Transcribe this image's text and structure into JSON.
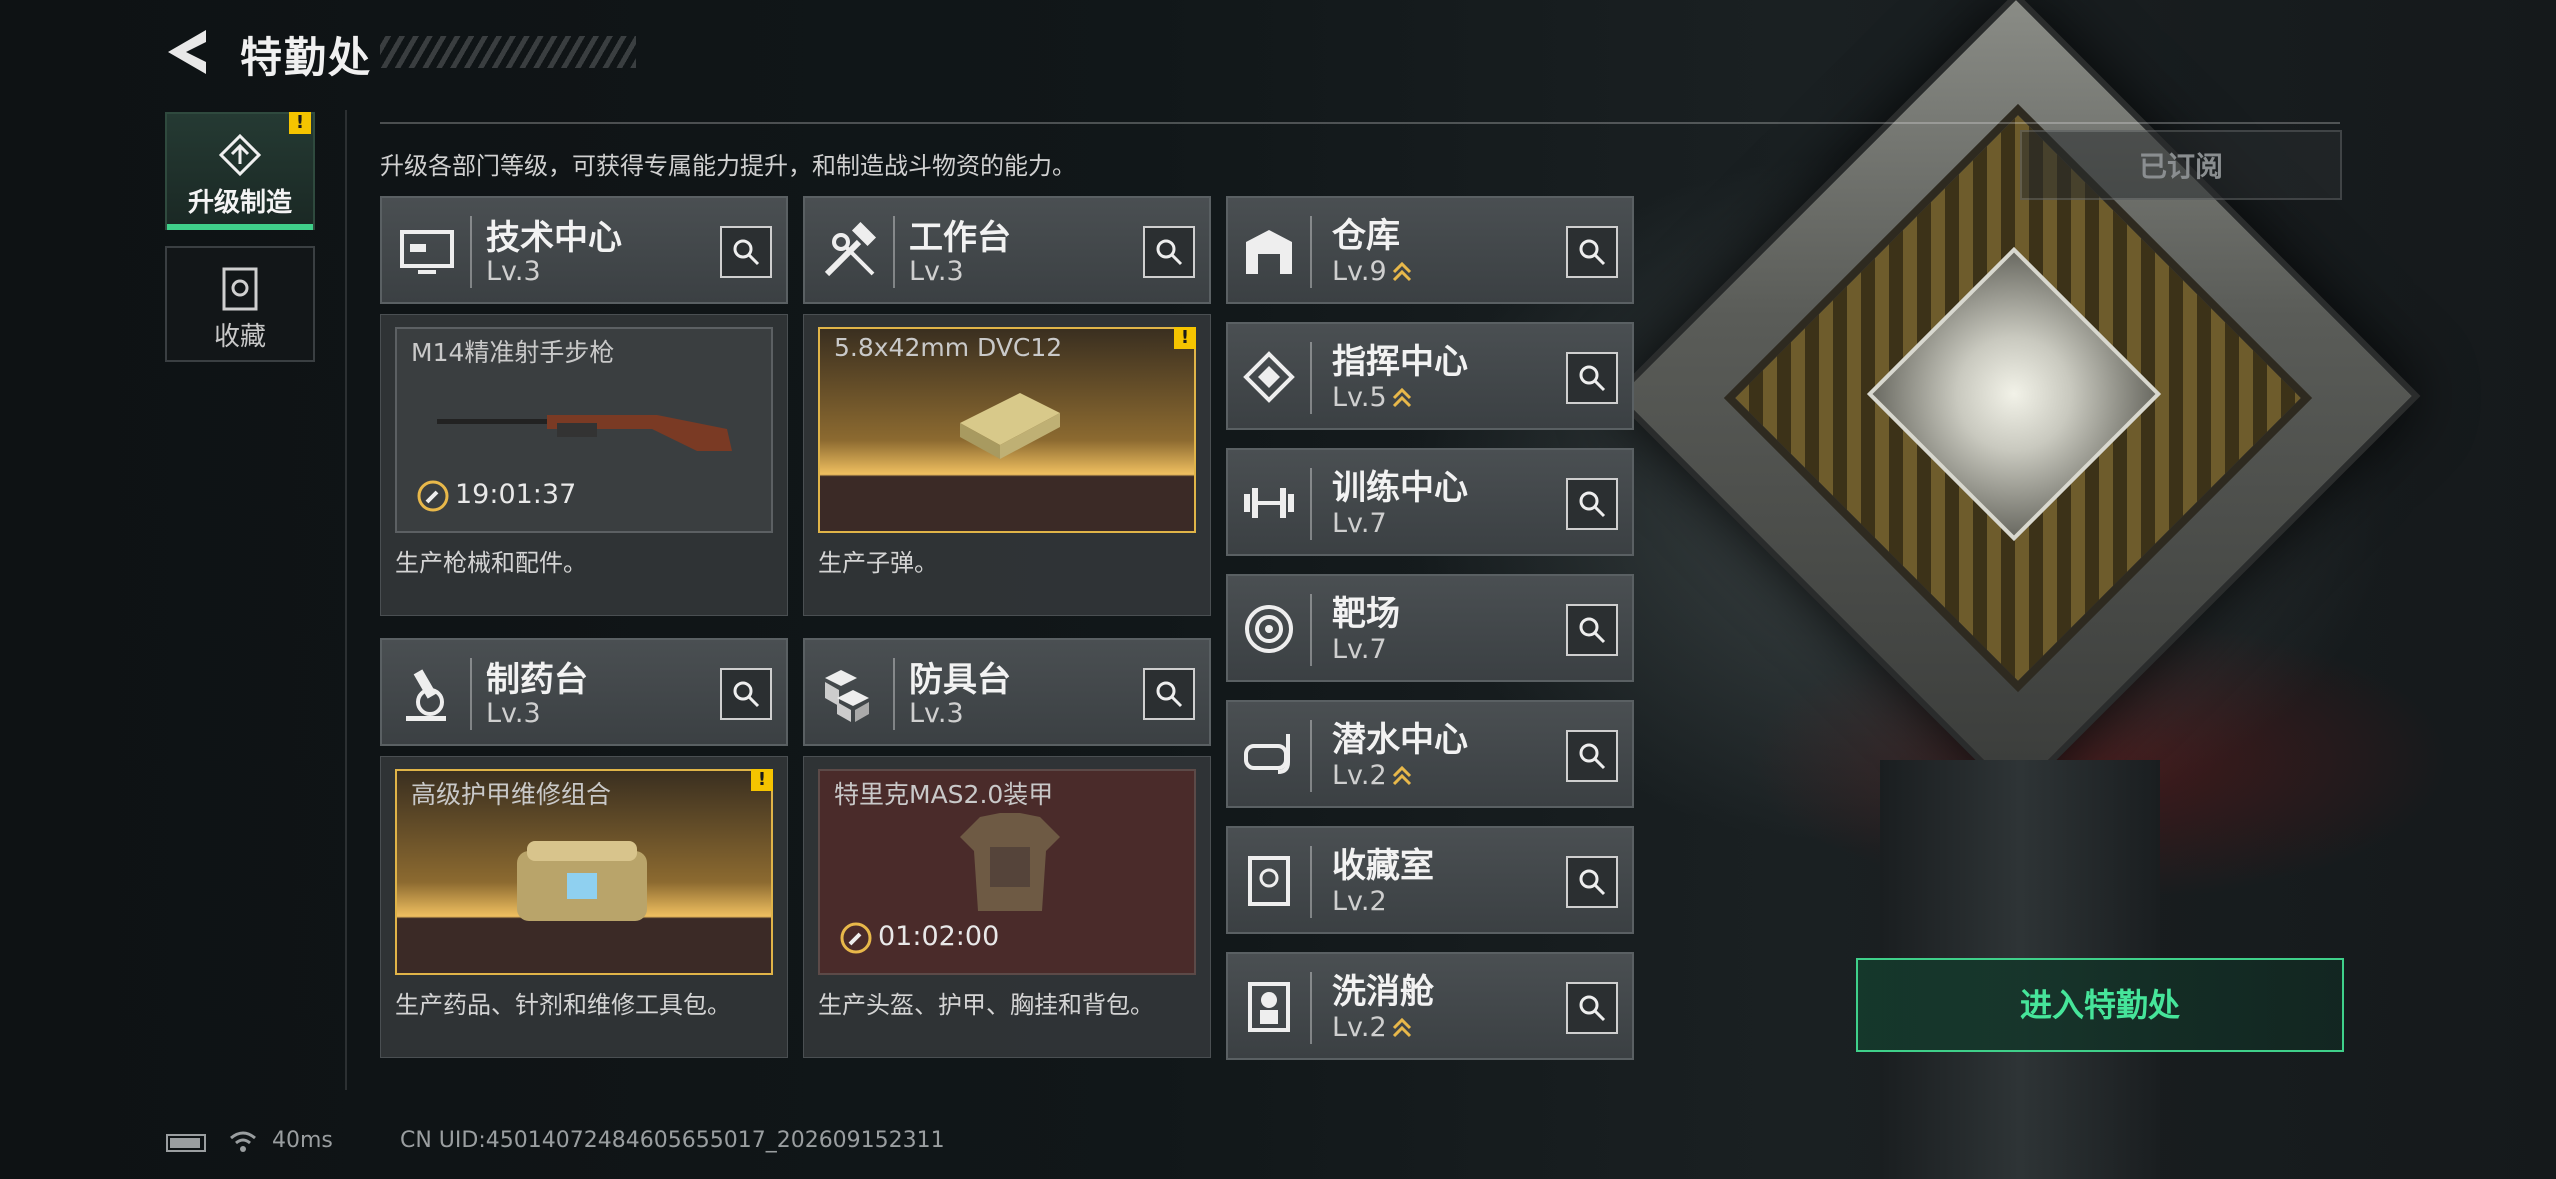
{
  "header": {
    "title": "特勤处"
  },
  "sidebar": {
    "tabs": [
      {
        "label": "升级制造",
        "active": true,
        "warning": "!"
      },
      {
        "label": "收藏",
        "active": false
      }
    ]
  },
  "description": "升级各部门等级，可获得专属能力提升，和制造战斗物资的能力。",
  "subscribed_label": "已订阅",
  "enter_button": "进入特勤处",
  "big_departments": [
    {
      "name": "技术中心",
      "level": "Lv.3",
      "product": "M14精准射手步枪",
      "timer": "19:01:37",
      "desc": "生产枪械和配件。",
      "frame": "grey",
      "icon": "monitor-icon"
    },
    {
      "name": "工作台",
      "level": "Lv.3",
      "product": "5.8x42mm DVC12",
      "timer": "",
      "desc": "生产子弹。",
      "frame": "gold",
      "warning": "!",
      "icon": "hammer-wrench-icon"
    },
    {
      "name": "制药台",
      "level": "Lv.3",
      "product": "高级护甲维修组合",
      "timer": "",
      "desc": "生产药品、针剂和维修工具包。",
      "frame": "gold",
      "warning": "!",
      "icon": "microscope-icon"
    },
    {
      "name": "防具台",
      "level": "Lv.3",
      "product": "特里克MAS2.0装甲",
      "timer": "01:02:00",
      "desc": "生产头盔、护甲、胸挂和背包。",
      "frame": "red",
      "icon": "boxes-icon"
    }
  ],
  "small_departments": [
    {
      "name": "仓库",
      "level": "Lv.9",
      "upgradable": true,
      "icon": "warehouse-icon"
    },
    {
      "name": "指挥中心",
      "level": "Lv.5",
      "upgradable": true,
      "icon": "command-chip-icon"
    },
    {
      "name": "训练中心",
      "level": "Lv.7",
      "upgradable": false,
      "icon": "dumbbell-icon"
    },
    {
      "name": "靶场",
      "level": "Lv.7",
      "upgradable": false,
      "icon": "target-icon"
    },
    {
      "name": "潜水中心",
      "level": "Lv.2",
      "upgradable": true,
      "icon": "diving-mask-icon"
    },
    {
      "name": "收藏室",
      "level": "Lv.2",
      "upgradable": false,
      "icon": "display-case-icon"
    },
    {
      "name": "洗消舱",
      "level": "Lv.2",
      "upgradable": true,
      "icon": "decon-suit-icon"
    }
  ],
  "footer": {
    "ping": "40ms",
    "uid": "CN UID:45014072484605655017_202609152311"
  },
  "colors": {
    "accent_green": "#3fd08a",
    "warning_yellow": "#f5c400",
    "upgrade_gold": "#e8b84a"
  }
}
